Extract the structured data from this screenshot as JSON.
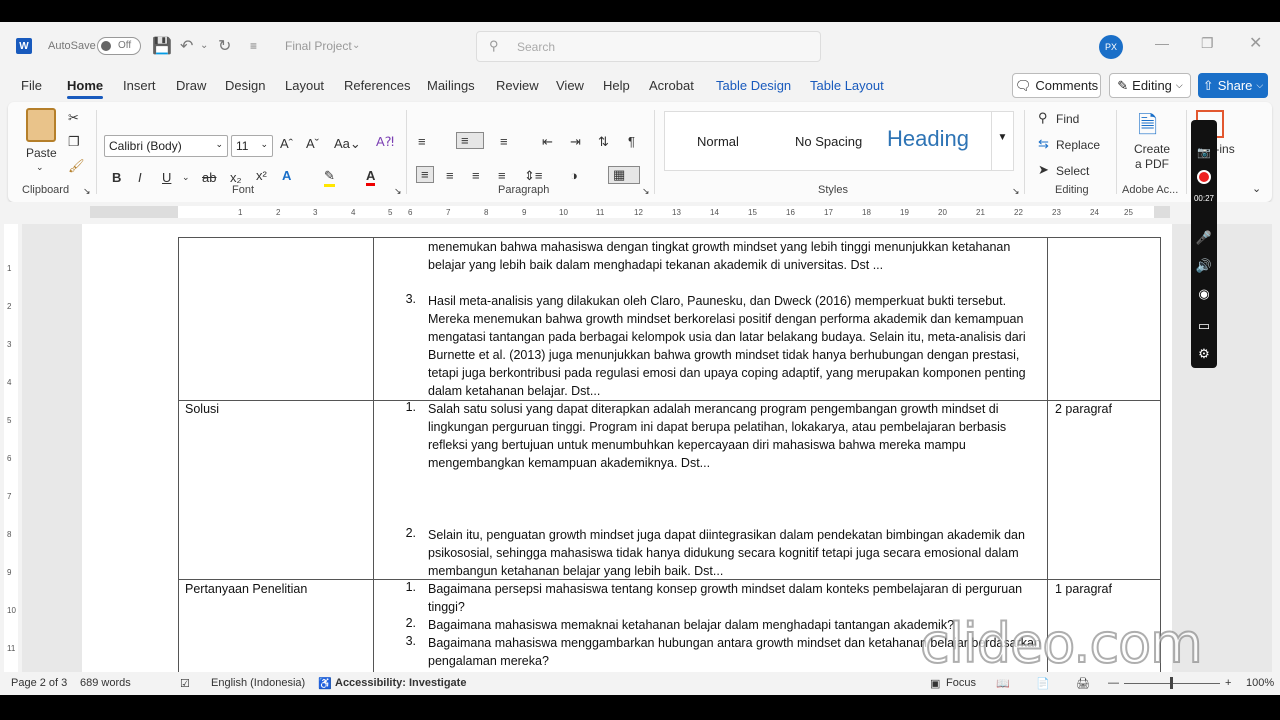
{
  "titlebar": {
    "autosave_label": "AutoSave",
    "autosave_state": "Off",
    "doc_title": "Final Project",
    "search_placeholder": "Search",
    "avatar_initials": "PX"
  },
  "menu": {
    "tabs": [
      "File",
      "Home",
      "Insert",
      "Draw",
      "Design",
      "Layout",
      "References",
      "Mailings",
      "Review",
      "View",
      "Help",
      "Acrobat",
      "Table Design",
      "Table Layout"
    ],
    "active_tab": "Home",
    "comments_label": "Comments",
    "editing_label": "Editing",
    "share_label": "Share"
  },
  "ribbon": {
    "paste_label": "Paste",
    "clipboard_label": "Clipboard",
    "font_name": "Calibri (Body)",
    "font_size": "11",
    "font_label": "Font",
    "paragraph_label": "Paragraph",
    "styles": [
      "Normal",
      "No Spacing",
      "Heading"
    ],
    "styles_label": "Styles",
    "find_label": "Find",
    "replace_label": "Replace",
    "select_label": "Select",
    "editing_label": "Editing",
    "create_pdf_label": "Create a PDF",
    "adobe_label": "Adobe Ac...",
    "addins_label": "Add-ins"
  },
  "ruler": {
    "ticks": [
      "1",
      "2",
      "3",
      "4",
      "5",
      "6",
      "7",
      "8",
      "9",
      "10",
      "11",
      "12",
      "13",
      "14",
      "15",
      "16",
      "17",
      "18",
      "19",
      "20",
      "21",
      "22",
      "23",
      "24",
      "25"
    ],
    "vticks": [
      "1",
      "2",
      "3",
      "4",
      "5",
      "6",
      "7",
      "8",
      "9",
      "10",
      "11"
    ]
  },
  "document": {
    "row1": {
      "cont_text": "menemukan bahwa mahasiswa dengan tingkat growth mindset yang lebih tinggi menunjukkan ketahanan belajar yang lebih baik dalam menghadapi tekanan akademik di universitas. Dst ...",
      "item_num": "3.",
      "item_text": "Hasil meta-analisis yang dilakukan oleh Claro, Paunesku, dan Dweck (2016) memperkuat bukti tersebut. Mereka menemukan bahwa growth mindset berkorelasi positif dengan performa akademik dan kemampuan mengatasi tantangan pada berbagai kelompok usia dan latar belakang budaya. Selain itu, meta-analisis dari Burnette et al. (2013) juga menunjukkan bahwa growth mindset tidak hanya berhubungan dengan prestasi, tetapi juga berkontribusi pada regulasi emosi dan upaya coping adaptif, yang merupakan komponen penting dalam ketahanan belajar. Dst..."
    },
    "row2": {
      "label": "Solusi",
      "item1_num": "1.",
      "item1_text": "Salah satu solusi yang dapat diterapkan adalah merancang program pengembangan growth mindset di lingkungan perguruan tinggi. Program ini dapat berupa pelatihan, lokakarya, atau pembelajaran berbasis refleksi yang bertujuan untuk menumbuhkan kepercayaan diri mahasiswa bahwa mereka mampu mengembangkan kemampuan akademiknya. Dst...",
      "item2_num": "2.",
      "item2_text": "Selain itu, penguatan growth mindset juga dapat diintegrasikan dalam pendekatan bimbingan akademik dan psikososial, sehingga mahasiswa tidak hanya didukung secara kognitif tetapi juga secara emosional dalam membangun ketahanan belajar yang lebih baik. Dst...",
      "note": "2 paragraf"
    },
    "row3": {
      "label": "Pertanyaan Penelitian",
      "q1_num": "1.",
      "q1_text": "Bagaimana persepsi mahasiswa tentang konsep growth mindset dalam konteks pembelajaran di perguruan tinggi?",
      "q2_num": "2.",
      "q2_text": "Bagaimana mahasiswa memaknai ketahanan belajar dalam menghadapi tantangan akademik?",
      "q3_num": "3.",
      "q3_text": "Bagaimana mahasiswa menggambarkan hubungan antara growth mindset dan ketahanan belajar berdasarkan pengalaman mereka?",
      "note": "1 paragraf"
    }
  },
  "statusbar": {
    "page": "Page 2 of 3",
    "words": "689 words",
    "language": "English (Indonesia)",
    "accessibility": "Accessibility: Investigate",
    "focus": "Focus",
    "zoom": "100%"
  },
  "recorder": {
    "time": "00:27"
  },
  "watermark": "clideo.com"
}
